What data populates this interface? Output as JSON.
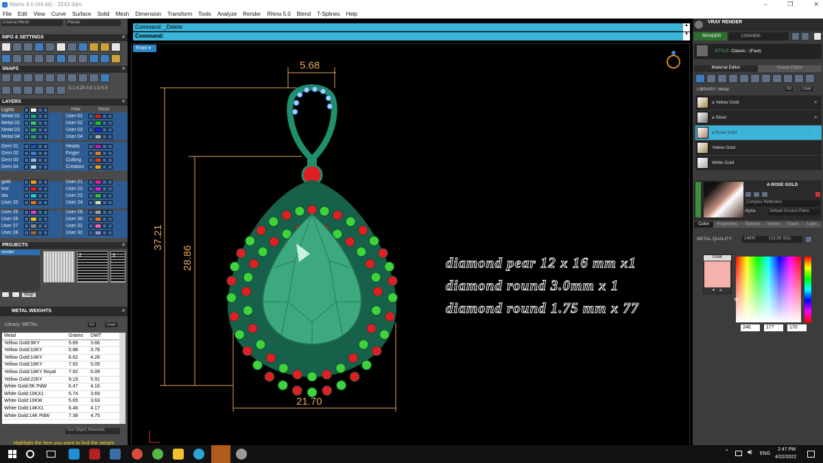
{
  "window": {
    "title": "Matrix 8.0 (64-bit) - 3243.3dm",
    "controls": [
      "–",
      "❐",
      "✕"
    ]
  },
  "menu": [
    "File",
    "Edit",
    "View",
    "Curve",
    "Surface",
    "Solid",
    "Mesh",
    "Dimension",
    "Transform",
    "Tools",
    "Analyze",
    "Render",
    "Rhino 5.0",
    "Blend",
    "T-Splines",
    "Help"
  ],
  "left": {
    "top_selects": [
      "Coarse Mesh",
      "Plastic"
    ],
    "sections": {
      "info": "INFO & SETTINGS",
      "snaps": "SNAPS",
      "layers": "LAYERS",
      "projects": "PROJECTS",
      "metal": "METAL WEIGHTS"
    },
    "snap_values": [
      "0.1",
      "0.25",
      "0.5",
      "1.0",
      "5.0"
    ],
    "layers_hide": "Hide",
    "layers_show": "Show",
    "layers_left": [
      {
        "name": "Lights",
        "color": "#ffffff"
      },
      {
        "name": "Metal 01",
        "color": "#1fa87a"
      },
      {
        "name": "Metal 02",
        "color": "#33cc66"
      },
      {
        "name": "Metal 03",
        "color": "#2fae5c"
      },
      {
        "name": "Metal 04",
        "color": "#2a9d75"
      },
      {
        "name": "Gem 01",
        "color": "#1e4fb5"
      },
      {
        "name": "Gem 02",
        "color": "#3a7fd6"
      },
      {
        "name": "Gem 03",
        "color": "#8db8ea"
      },
      {
        "name": "Gem 04",
        "color": "#bcd6f4"
      },
      {
        "name": "gold",
        "color": "#e8a21a"
      },
      {
        "name": "line",
        "color": "#e02020"
      },
      {
        "name": "dia",
        "color": "#27c7dd"
      },
      {
        "name": "User 20",
        "color": "#e07020"
      },
      {
        "name": "User 25",
        "color": "#cc44cc"
      },
      {
        "name": "User 26",
        "color": "#e8c020"
      },
      {
        "name": "User 27",
        "color": "#8a8a8a"
      },
      {
        "name": "User 28",
        "color": "#9b6a3a"
      }
    ],
    "layers_right": [
      {
        "name": "User 01",
        "color": "#e02020"
      },
      {
        "name": "User 02",
        "color": "#22c22c"
      },
      {
        "name": "User 03",
        "color": "#2020e0"
      },
      {
        "name": "User 04",
        "color": "#aaaaaa"
      },
      {
        "name": "Heads",
        "color": "#b020b0"
      },
      {
        "name": "Finger",
        "color": "#e08020"
      },
      {
        "name": "Cutting",
        "color": "#e04020"
      },
      {
        "name": "Creation",
        "color": "#f0a020"
      },
      {
        "name": "User 21",
        "color": "#e020a0"
      },
      {
        "name": "User 22",
        "color": "#e020e0"
      },
      {
        "name": "User 23",
        "color": "#40c040"
      },
      {
        "name": "User 24",
        "color": "#c0e0c0"
      },
      {
        "name": "User 29",
        "color": "#a0a0a0"
      },
      {
        "name": "User 30",
        "color": "#e07030"
      },
      {
        "name": "User 31",
        "color": "#ea66b0"
      },
      {
        "name": "User 32",
        "color": "#9090e0"
      }
    ],
    "project_item": "render",
    "project_nums": [
      "2",
      "3"
    ],
    "project_btn": "Nlogr",
    "library_label": "Library: METAL",
    "library_btns": [
      "0V",
      "User"
    ],
    "metal_headers": [
      "Metal",
      "Grams",
      "DWT"
    ],
    "metals": [
      [
        "Yellow Gold:9KY",
        "5.69",
        "3.66"
      ],
      [
        "Yellow Gold:10KY",
        "5.88",
        "3.78"
      ],
      [
        "Yellow Gold:14KY",
        "6.62",
        "4.26"
      ],
      [
        "Yellow Gold:18KY",
        "7.92",
        "5.09"
      ],
      [
        "Yellow Gold:18KY Royal",
        "7.92",
        "5.09"
      ],
      [
        "Yellow Gold:22KY",
        "9.19",
        "5.91"
      ],
      [
        "White Gold:9K PdW",
        "6.47",
        "4.16"
      ],
      [
        "White Gold:10KX1",
        "5.74",
        "3.69"
      ],
      [
        "White Gold:10KW",
        "5.65",
        "3.63"
      ],
      [
        "White Gold:14KX1",
        "6.48",
        "4.17"
      ],
      [
        "White Gold:14K PdW",
        "7.38",
        "4.75"
      ]
    ],
    "use_object": "Use Object Materials",
    "hint": "Highlight the item you want to find the weight"
  },
  "command": {
    "history": "Command: _Delete",
    "prompt": "Command:"
  },
  "viewport": {
    "label": "Front",
    "dims": [
      "5.68",
      "37.21",
      "28.86",
      "21.70"
    ],
    "specs": [
      "diamond  pear  12 x 16 mm x1",
      "diamond  round      3.0mm x 1",
      "diamond  round   1.75 mm x 77"
    ]
  },
  "right": {
    "title": "VRAY RENDER",
    "render_btn": "RENDER",
    "resolution": "1200x900",
    "preset": "Classic - (Fast)",
    "preset_prefix": "STYLE:",
    "tabs": [
      "Material Editor",
      "Scene Editor"
    ],
    "library_label": "LIBRARY: Metal",
    "library_btns": [
      "0V",
      "User"
    ],
    "materials": [
      "a Yellow Gold",
      "a Silver",
      "a Rose Gold",
      "Yellow Gold",
      "White Gold"
    ],
    "selected_material": "A ROSE GOLD",
    "reflection": "Complex Reflection",
    "alpha": "Alpha",
    "ground": "Default Ground Plane",
    "subtabs": [
      "Color",
      "Properties",
      "Texture",
      "Scene",
      "Trace",
      "Light"
    ],
    "quality_label": "METAL QUALITY:",
    "quality_value": "14KR",
    "quality_ref": "(13.00 SG)",
    "color_label": "Color",
    "rgb": [
      "246",
      "177",
      "170"
    ],
    "swatch": "#f6b1aa"
  },
  "taskbar": {
    "lang": "ENG",
    "time": "2:47 PM",
    "date": "4/22/2022"
  }
}
